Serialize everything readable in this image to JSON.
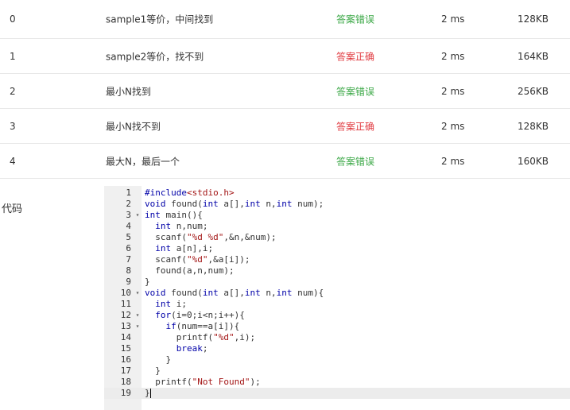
{
  "results": [
    {
      "index": "0",
      "name": "sample1等价，中间找到",
      "status": "答案错误",
      "status_type": "err-green",
      "time": "2 ms",
      "memory": "128KB"
    },
    {
      "index": "1",
      "name": "sample2等价，找不到",
      "status": "答案正确",
      "status_type": "ok-red",
      "time": "2 ms",
      "memory": "164KB"
    },
    {
      "index": "2",
      "name": "最小N找到",
      "status": "答案错误",
      "status_type": "err-green",
      "time": "2 ms",
      "memory": "256KB"
    },
    {
      "index": "3",
      "name": "最小N找不到",
      "status": "答案正确",
      "status_type": "ok-red",
      "time": "2 ms",
      "memory": "128KB"
    },
    {
      "index": "4",
      "name": "最大N，最后一个",
      "status": "答案错误",
      "status_type": "err-green",
      "time": "2 ms",
      "memory": "160KB"
    }
  ],
  "colors": {
    "status_green": "#3aa745",
    "status_red": "#e0383e"
  },
  "code_label": "代码",
  "code": {
    "lines": [
      {
        "n": "1",
        "fold": false,
        "text": "#include<stdio.h>"
      },
      {
        "n": "2",
        "fold": false,
        "text": "void found(int a[],int n,int num);"
      },
      {
        "n": "3",
        "fold": true,
        "text": "int main(){"
      },
      {
        "n": "4",
        "fold": false,
        "text": "  int n,num;"
      },
      {
        "n": "5",
        "fold": false,
        "text": "  scanf(\"%d %d\",&n,&num);"
      },
      {
        "n": "6",
        "fold": false,
        "text": "  int a[n],i;"
      },
      {
        "n": "7",
        "fold": false,
        "text": "  scanf(\"%d\",&a[i]);"
      },
      {
        "n": "8",
        "fold": false,
        "text": "  found(a,n,num);"
      },
      {
        "n": "9",
        "fold": false,
        "text": "}"
      },
      {
        "n": "10",
        "fold": true,
        "text": "void found(int a[],int n,int num){"
      },
      {
        "n": "11",
        "fold": false,
        "text": "  int i;"
      },
      {
        "n": "12",
        "fold": true,
        "text": "  for(i=0;i<n;i++){"
      },
      {
        "n": "13",
        "fold": true,
        "text": "    if(num==a[i]){"
      },
      {
        "n": "14",
        "fold": false,
        "text": "      printf(\"%d\",i);"
      },
      {
        "n": "15",
        "fold": false,
        "text": "      break;"
      },
      {
        "n": "16",
        "fold": false,
        "text": "    }"
      },
      {
        "n": "17",
        "fold": false,
        "text": "  }"
      },
      {
        "n": "18",
        "fold": false,
        "text": "  printf(\"Not Found\");"
      },
      {
        "n": "19",
        "fold": false,
        "text": "}"
      }
    ],
    "active_line": "19",
    "fold_icon": "caret-down-icon"
  }
}
